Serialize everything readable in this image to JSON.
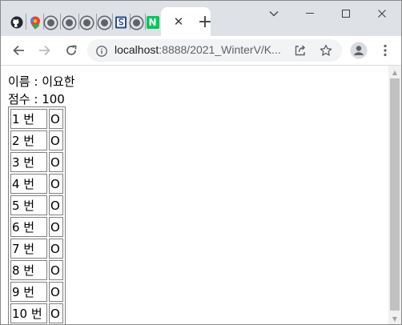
{
  "browser": {
    "tabs": [
      {
        "icon": "github-icon",
        "color": "#24292f"
      },
      {
        "icon": "maps-pin-icon",
        "color": "#ea4335"
      },
      {
        "icon": "globe-icon",
        "color": "#5f6368"
      },
      {
        "icon": "globe-icon",
        "color": "#5f6368"
      },
      {
        "icon": "globe-icon",
        "color": "#5f6368"
      },
      {
        "icon": "globe-icon",
        "color": "#5f6368"
      },
      {
        "icon": "doc-s-icon",
        "color": "#2b4c8c"
      },
      {
        "icon": "globe-icon",
        "color": "#5f6368"
      },
      {
        "icon": "naver-n-icon",
        "color": "#03c75a",
        "label": "N"
      }
    ],
    "active_tab_close": "✕",
    "new_tab": "+",
    "url_host": "localhost",
    "url_rest": ":8888/2021_WinterV/K..."
  },
  "page": {
    "name_line": "이름 : 이요한",
    "score_line": "점수 : 100",
    "rows": [
      {
        "num": "1 번",
        "mark": "O"
      },
      {
        "num": "2 번",
        "mark": "O"
      },
      {
        "num": "3 번",
        "mark": "O"
      },
      {
        "num": "4 번",
        "mark": "O"
      },
      {
        "num": "5 번",
        "mark": "O"
      },
      {
        "num": "6 번",
        "mark": "O"
      },
      {
        "num": "7 번",
        "mark": "O"
      },
      {
        "num": "8 번",
        "mark": "O"
      },
      {
        "num": "9 번",
        "mark": "O"
      },
      {
        "num": "10 번",
        "mark": "O"
      }
    ]
  }
}
